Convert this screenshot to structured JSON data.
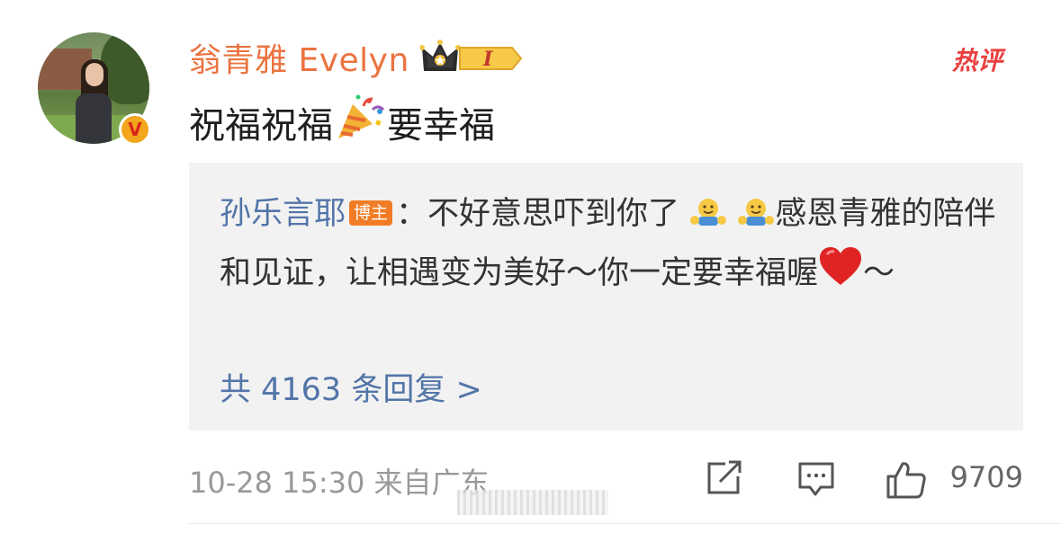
{
  "comment": {
    "username": "翁青雅 Evelyn",
    "vip_level": "I",
    "hot_label": "热评",
    "text_before_emoji": "祝福祝福",
    "text_after_emoji": "要幸福",
    "emoji": "party-popper",
    "timestamp": "10-28 15:30",
    "location": "来自广东",
    "like_count": "9709"
  },
  "reply": {
    "author": "孙乐言耶",
    "author_tag": "博主",
    "separator": "：",
    "text_part1": "不好意思吓到你了",
    "text_part2": "感恩青雅的陪伴和见证，让相遇变为美好～你一定要幸福喔",
    "text_part3": "～",
    "emojis": [
      "hug",
      "hug",
      "red-heart"
    ],
    "total_replies": "共 4163 条回复 >"
  },
  "colors": {
    "username": "#eb7340",
    "link_blue": "#5275a8",
    "hot_red": "#ea3f3f",
    "host_tag_bg": "#f27c25",
    "reply_bg": "#f2f2f2"
  }
}
